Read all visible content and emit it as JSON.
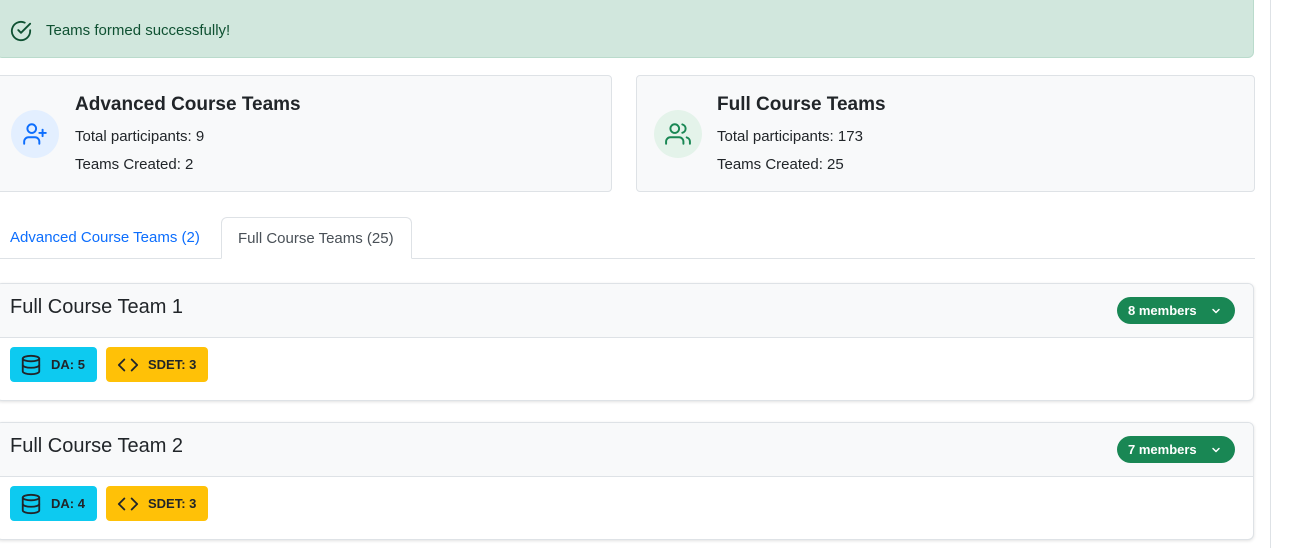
{
  "alert": {
    "message": "Teams formed successfully!",
    "icon": "check-circle-icon"
  },
  "summary": [
    {
      "title": "Advanced Course Teams",
      "participants": "Total participants: 9",
      "teams": "Teams Created: 2",
      "icon": "user-plus-icon",
      "accent": "#0d6efd"
    },
    {
      "title": "Full Course Teams",
      "participants": "Total participants: 173",
      "teams": "Teams Created: 25",
      "icon": "users-icon",
      "accent": "#198754"
    }
  ],
  "tabs": [
    {
      "label": "Advanced Course Teams (2)",
      "active": false
    },
    {
      "label": "Full Course Teams (25)",
      "active": true
    }
  ],
  "teams": [
    {
      "name": "Full Course Team 1",
      "members": "8 members",
      "roles": [
        {
          "label": "DA: 5",
          "icon": "database-icon"
        },
        {
          "label": "SDET: 3",
          "icon": "code-icon"
        }
      ]
    },
    {
      "name": "Full Course Team 2",
      "members": "7 members",
      "roles": [
        {
          "label": "DA: 4",
          "icon": "database-icon"
        },
        {
          "label": "SDET: 3",
          "icon": "code-icon"
        }
      ]
    }
  ],
  "colors": {
    "success": "#198754",
    "info": "#0dcaf0",
    "warning": "#ffc107",
    "primary": "#0d6efd"
  }
}
